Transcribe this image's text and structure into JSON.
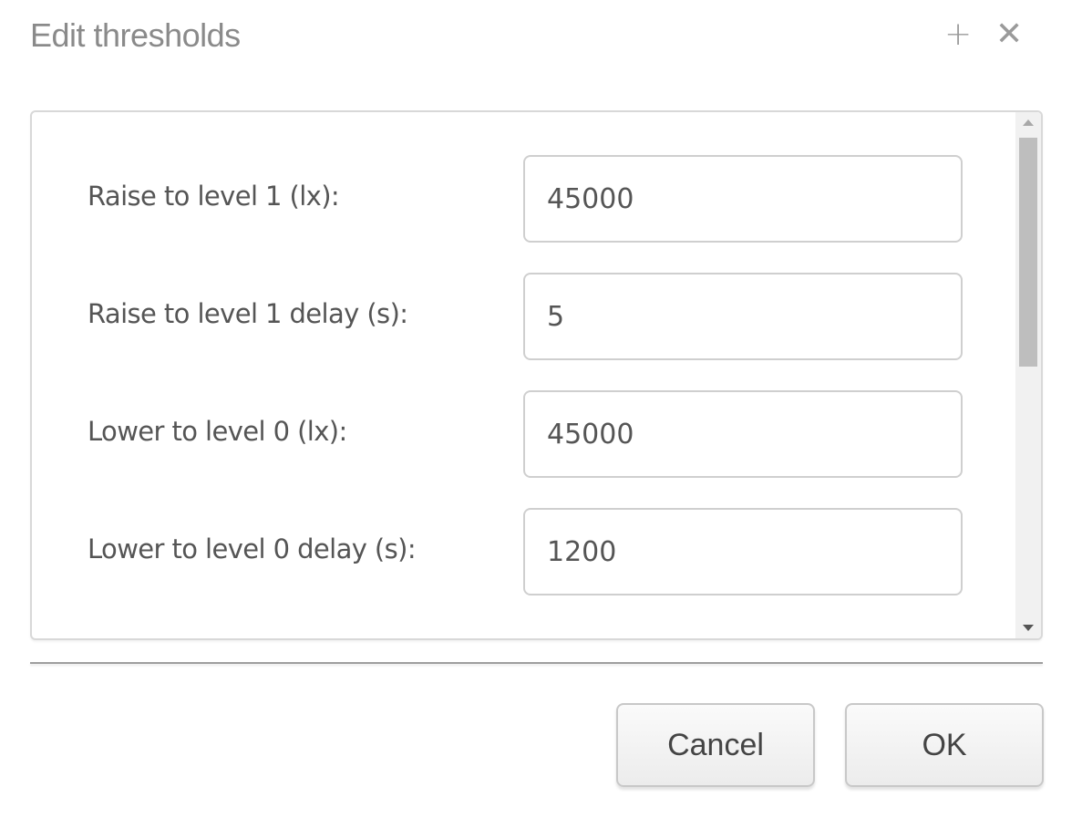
{
  "dialog": {
    "title": "Edit thresholds",
    "expand_icon": "+",
    "close_icon": "✕"
  },
  "fields": [
    {
      "label": "Raise to level 1 (lx):",
      "value": "45000"
    },
    {
      "label": "Raise to level 1 delay (s):",
      "value": "5"
    },
    {
      "label": "Lower to level 0 (lx):",
      "value": "45000"
    },
    {
      "label": "Lower to level 0 delay (s):",
      "value": "1200"
    }
  ],
  "buttons": {
    "cancel": "Cancel",
    "ok": "OK"
  }
}
